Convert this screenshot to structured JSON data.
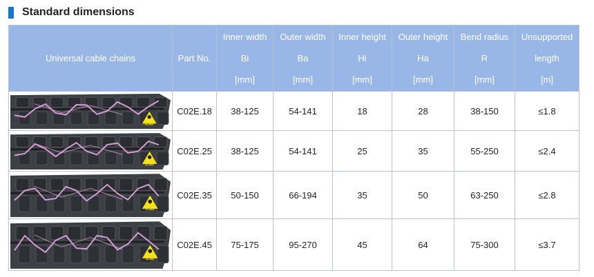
{
  "section": {
    "title": "Standard dimensions",
    "accent": "#1a75c8"
  },
  "table": {
    "header_color": "#99b7e6",
    "headers": [
      {
        "lines": [
          "Universal cable chains"
        ]
      },
      {
        "lines": [
          "Part No."
        ]
      },
      {
        "lines": [
          "Inner width",
          "Bi",
          "[mm]"
        ]
      },
      {
        "lines": [
          "Outer width",
          "Ba",
          "[mm]"
        ]
      },
      {
        "lines": [
          "Inner height",
          "Hi",
          "[mm]"
        ]
      },
      {
        "lines": [
          "Outer height",
          "Ha",
          "[mm]"
        ]
      },
      {
        "lines": [
          "Bend radius",
          "R",
          "[mm]"
        ]
      },
      {
        "lines": [
          "Unsupported",
          "length",
          "[m]"
        ]
      }
    ],
    "rows": [
      {
        "part": "C02E.18",
        "bi": "38-125",
        "ba": "54-141",
        "hi": "18",
        "ha": "28",
        "r": "38-150",
        "len": "≤1.8"
      },
      {
        "part": "C02E.25",
        "bi": "38-125",
        "ba": "54-141",
        "hi": "25",
        "ha": "35",
        "r": "55-250",
        "len": "≤2.4"
      },
      {
        "part": "C02E.35",
        "bi": "50-150",
        "ba": "66-194",
        "hi": "35",
        "ha": "50",
        "r": "63-250",
        "len": "≤2.8"
      },
      {
        "part": "C02E.45",
        "bi": "75-175",
        "ba": "95-270",
        "hi": "45",
        "ha": "64",
        "r": "75-300",
        "len": "≤3.7"
      }
    ],
    "image": {
      "icon": "esd-warning-icon",
      "badge_text": "ESD",
      "chain_color": "#3c3f43",
      "lightning_color": "#e6a8e8",
      "badge_color": "#f3e21a"
    }
  }
}
